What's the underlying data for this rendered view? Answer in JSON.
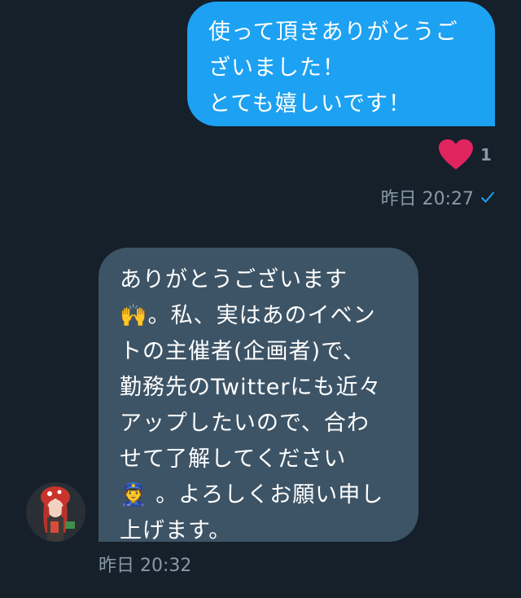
{
  "conversation": {
    "outgoing_message": {
      "text": "使って頂きありがとうご\nざいました！\nとても嬉しいです！",
      "reaction_icon": "heart-icon",
      "reaction_count": "1",
      "timestamp": "昨日 20:27",
      "status_icon": "checkmark-icon"
    },
    "incoming_message": {
      "text": "ありがとうございます\n🙌。私、実はあのイベン\nトの主催者(企画者)で、\n勤務先のTwitterにも近々\nアップしたいので、合わ\nせて了解してください\n👮 。よろしくお願い申し\n上げます。",
      "timestamp": "昨日 20:32",
      "avatar_icon": "avatar"
    }
  },
  "colors": {
    "background": "#15202b",
    "outgoing_bubble": "#1da1f2",
    "incoming_bubble": "#3d5466",
    "heart": "#e0245e",
    "meta_text": "#8899a6"
  }
}
